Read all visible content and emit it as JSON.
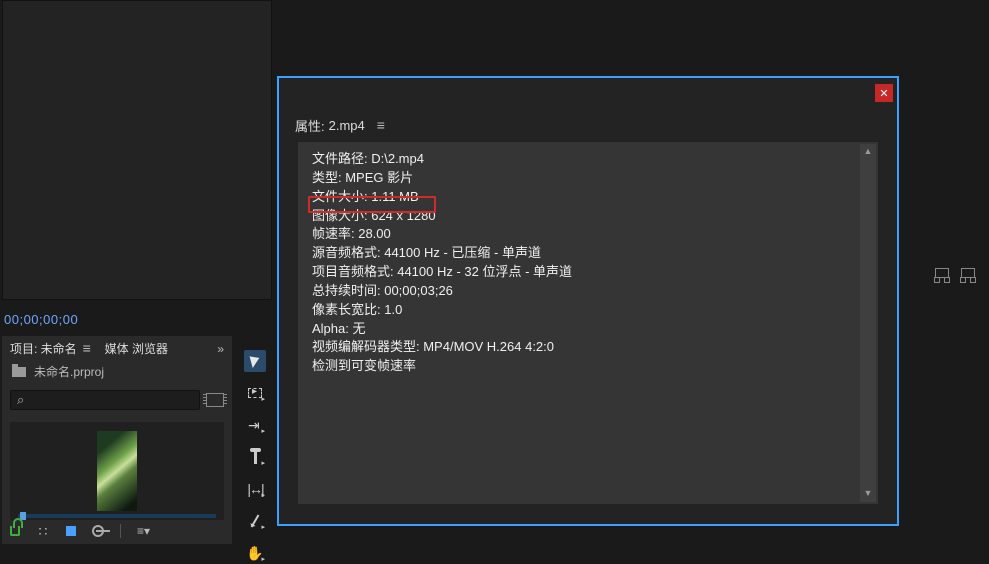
{
  "monitor": {
    "timecode": "00;00;00;00"
  },
  "project": {
    "tab_label": "项目: 未命名",
    "browser_label": "媒体 浏览器",
    "overflow": "»",
    "filename": "未命名.prproj",
    "search_placeholder": "⌕"
  },
  "dialog": {
    "header_prefix": "属性:",
    "header_file": "2.mp4",
    "rows": {
      "path": "文件路径: D:\\2.mp4",
      "type": "类型: MPEG 影片",
      "filesize": "文件大小: 1.11 MB",
      "imagesize": "图像大小: 624 x 1280",
      "framerate": "帧速率: 28.00",
      "src_audio": "源音频格式: 44100 Hz - 已压缩 - 单声道",
      "proj_audio": "项目音频格式: 44100 Hz - 32 位浮点 - 单声道",
      "duration": "总持续时间: 00;00;03;26",
      "par": "像素长宽比: 1.0",
      "alpha": "Alpha: 无",
      "codec": "视频编解码器类型: MP4/MOV H.264 4:2:0",
      "vfr": "检测到可变帧速率"
    }
  }
}
